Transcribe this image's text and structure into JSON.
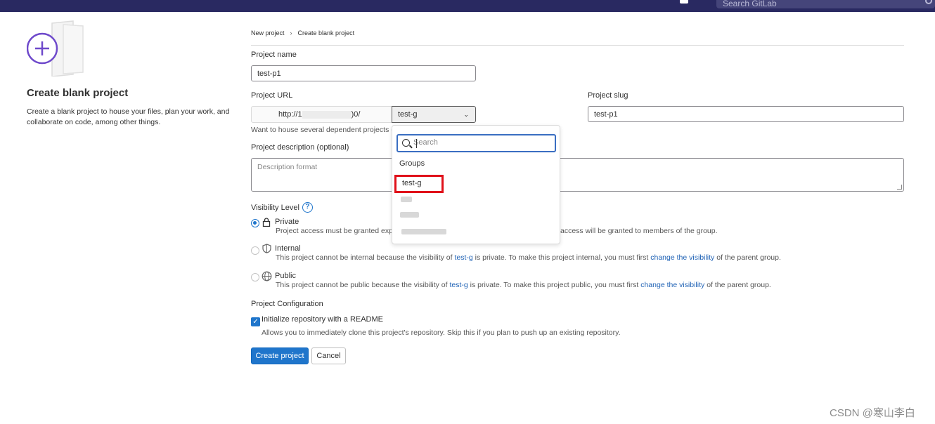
{
  "topbar": {
    "search_placeholder": "Search GitLab"
  },
  "left": {
    "title": "Create blank project",
    "description": "Create a blank project to house your files, plan your work, and collaborate on code, among other things."
  },
  "breadcrumb": {
    "items": [
      "New project",
      "Create blank project"
    ],
    "separator": "›"
  },
  "form": {
    "project_name_label": "Project name",
    "project_name_value": "test-p1",
    "project_url_label": "Project URL",
    "project_url_prefix_start": "http://1",
    "project_url_prefix_end": ")0/",
    "namespace_value": "test-g",
    "project_slug_label": "Project slug",
    "project_slug_value": "test-p1",
    "url_hint": "Want to house several dependent projects (",
    "description_label": "Project description (optional)",
    "description_placeholder": "Description format"
  },
  "dropdown": {
    "search_placeholder": "Search",
    "header": "Groups",
    "selected_item": "test-g"
  },
  "visibility": {
    "label": "Visibility Level",
    "help": "?",
    "options": [
      {
        "name": "Private",
        "desc_a": "Project access must be granted expli",
        "desc_b": "access will be granted to members of the group."
      },
      {
        "name": "Internal",
        "desc_a": "This project cannot be internal because the visibility of ",
        "link1": "test-g",
        "desc_b": " is private. To make this project internal, you must first ",
        "link2": "change the visibility",
        "desc_c": " of the parent group."
      },
      {
        "name": "Public",
        "desc_a": "This project cannot be public because the visibility of ",
        "link1": "test-g",
        "desc_b": " is private. To make this project public, you must first ",
        "link2": "change the visibility",
        "desc_c": " of the parent group."
      }
    ]
  },
  "config": {
    "label": "Project Configuration",
    "readme_label": "Initialize repository with a README",
    "readme_desc": "Allows you to immediately clone this project's repository. Skip this if you plan to push up an existing repository."
  },
  "buttons": {
    "create": "Create project",
    "cancel": "Cancel"
  },
  "watermark": "CSDN @寒山李白",
  "colors": {
    "topbar": "#292961",
    "accent": "#1f75cb",
    "highlight": "#e0111a"
  },
  "icons": {
    "lock": "lock-icon",
    "shield": "shield-icon",
    "globe": "globe-icon"
  }
}
